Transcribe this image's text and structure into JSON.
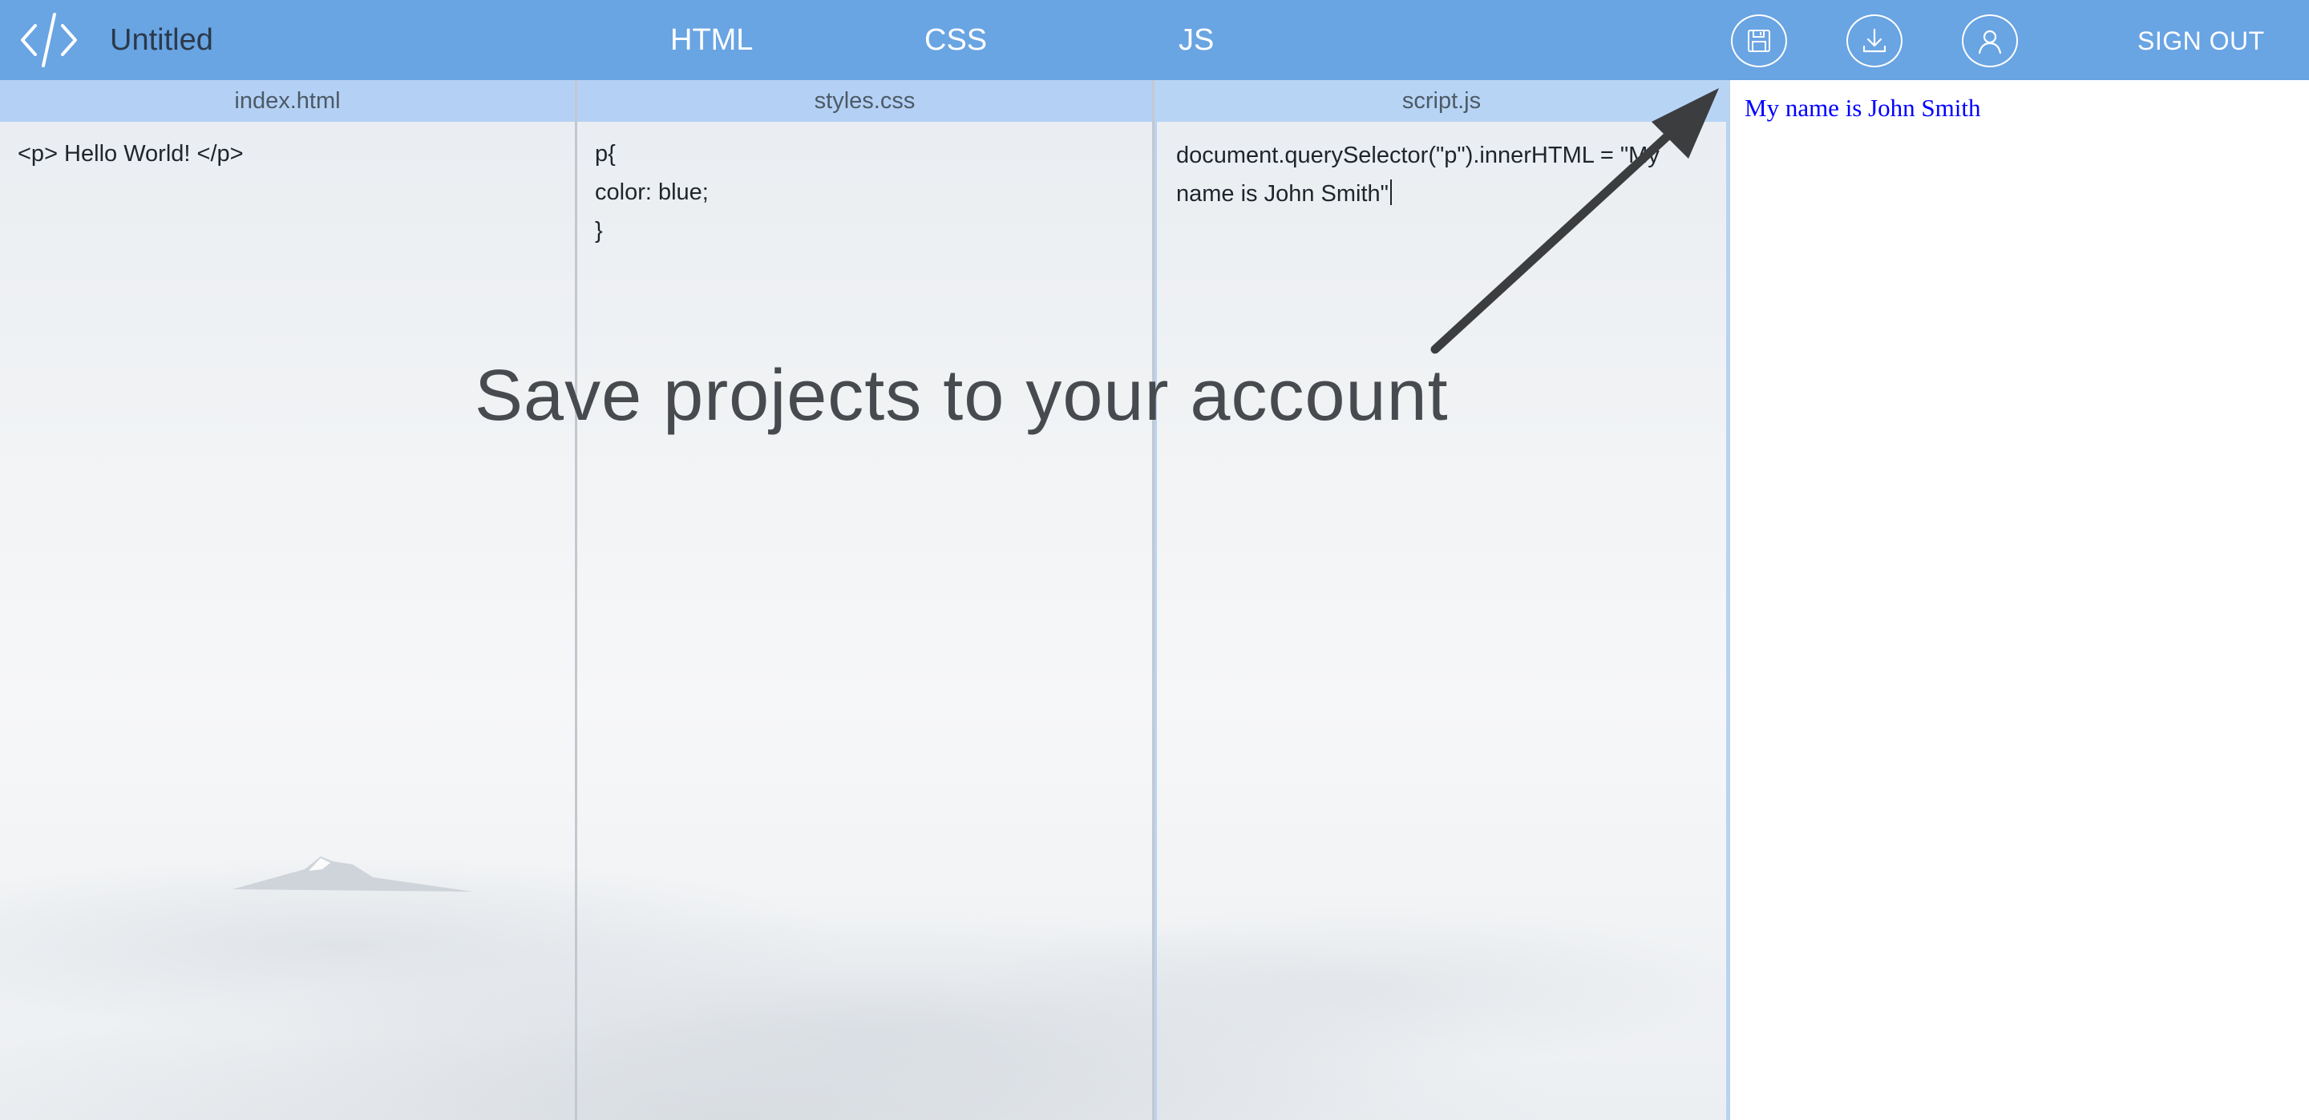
{
  "app": {
    "project_title": "Untitled",
    "logo_icon": "code-brackets-icon"
  },
  "nav": {
    "tabs": [
      {
        "label": "HTML"
      },
      {
        "label": "CSS"
      },
      {
        "label": "JS"
      }
    ]
  },
  "toolbar": {
    "save_icon": "floppy-disk-icon",
    "download_icon": "download-icon",
    "account_icon": "user-icon",
    "signout_label": "SIGN OUT"
  },
  "editors": [
    {
      "filename": "index.html",
      "code": "<p> Hello World! </p>"
    },
    {
      "filename": "styles.css",
      "code": "p{\ncolor: blue;\n}"
    },
    {
      "filename": "script.js",
      "code": "document.querySelector(\"p\").innerHTML = \"My name is John Smith\""
    }
  ],
  "tip": {
    "text": "Save projects to your account"
  },
  "preview": {
    "text": "My name is John Smith",
    "text_color": "#0000ff"
  },
  "colors": {
    "topbar": "#69a4e3",
    "pane_header": "#b4d1f5",
    "arrow": "#3b3d3f"
  }
}
